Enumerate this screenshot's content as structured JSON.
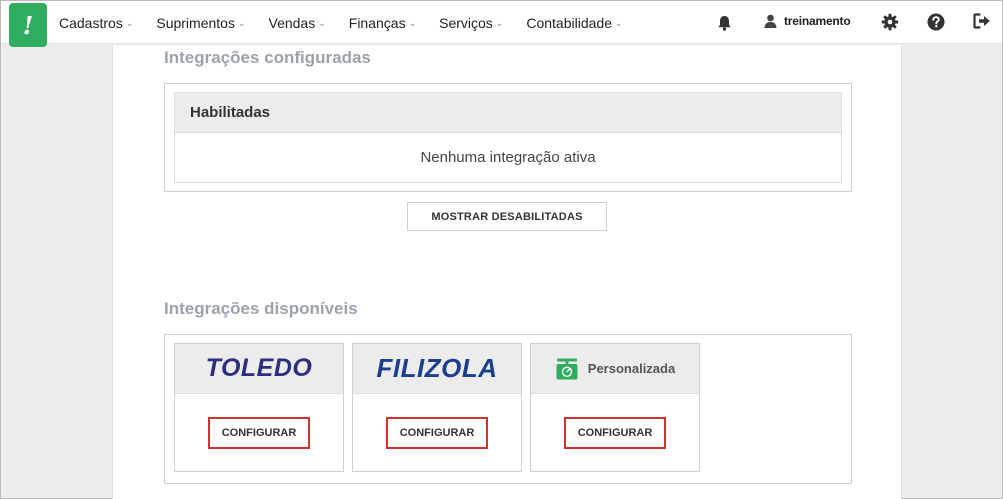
{
  "nav": {
    "logo": "!",
    "menu": [
      {
        "label": "Cadastros"
      },
      {
        "label": "Suprimentos"
      },
      {
        "label": "Vendas"
      },
      {
        "label": "Finanças"
      },
      {
        "label": "Serviços"
      },
      {
        "label": "Contabilidade"
      }
    ],
    "user_name": "treinamento"
  },
  "configured": {
    "title": "Integrações configuradas",
    "enabled_header": "Habilitadas",
    "empty_message": "Nenhuma integração ativa",
    "show_disabled_label": "MOSTRAR DESABILITADAS"
  },
  "available": {
    "title": "Integrações disponíveis",
    "cards": [
      {
        "brand": "TOLEDO",
        "button": "CONFIGURAR"
      },
      {
        "brand": "FILIZOLA",
        "button": "CONFIGURAR"
      },
      {
        "brand": "Personalizada",
        "button": "CONFIGURAR",
        "icon": "scale-icon"
      }
    ]
  },
  "colors": {
    "brand_green": "#2fae5f",
    "config_border": "#d32f2f",
    "section_title": "#9aa3ad"
  }
}
